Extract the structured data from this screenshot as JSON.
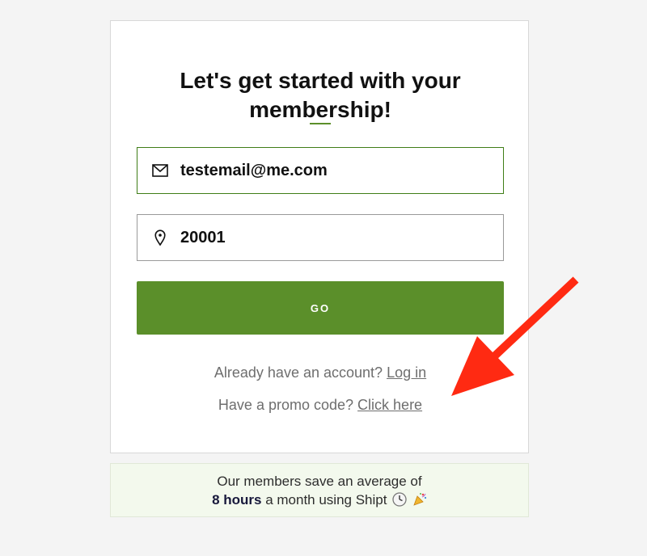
{
  "signup": {
    "title_line1": "Let's get started with your",
    "title_line2": "membership!",
    "email_value": "testemail@me.com",
    "zip_value": "20001",
    "go_label": "GO",
    "login_prompt": "Already have an account?",
    "login_link": "Log in",
    "promo_prompt": "Have a promo code?",
    "promo_link": "Click here"
  },
  "banner": {
    "line1": "Our members save an average of",
    "highlight": "8 hours",
    "line2_rest": "a month using Shipt"
  },
  "icons": {
    "email": "envelope-icon",
    "zip": "map-pin-icon",
    "clock": "clock-emoji-icon",
    "party": "party-popper-emoji-icon",
    "annotation": "red-arrow-icon"
  },
  "colors": {
    "brand_green": "#5b8f2a",
    "annotation_red": "#ff2a12"
  }
}
